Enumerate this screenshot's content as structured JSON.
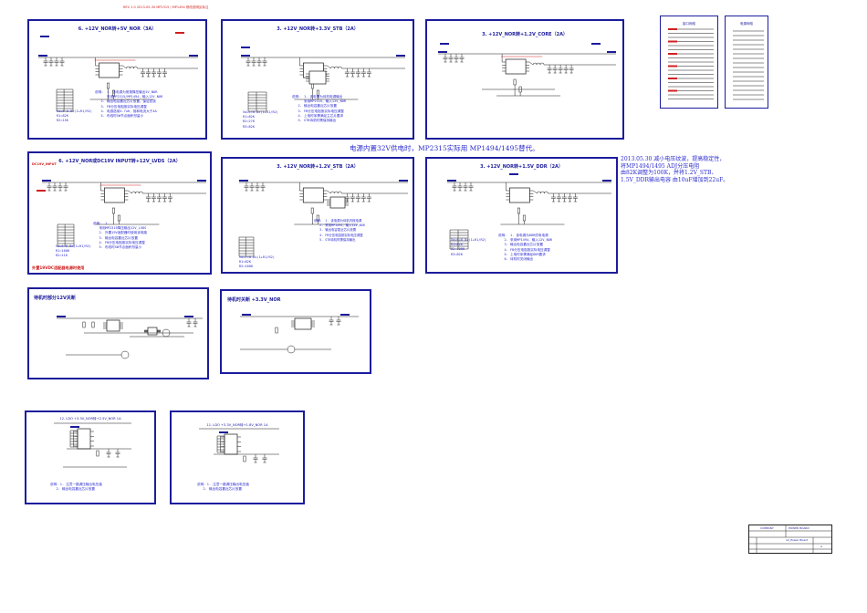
{
  "top_note": "REV 1.0  2013-05-30  MP2315 / MP1494  修改说明见标注",
  "center_note": "电源内置32V供电时，MP2315实际用 MP1494/1495替代。",
  "right_note": "2013.05.30 减小电压纹波，提高稳定性，\n将MP1494/1495 ADJ分压电阻\n由82K调整为100K，并将1.2V_STB、\n1.5V_DDR输出电容 由10uF增加到22uF。",
  "red_warning": "外置19VDC适配器电源时使用",
  "red_label_dc": "DC19V_INPUT",
  "blocks": {
    "b1": {
      "title": "6. +12V_NOR转+5V_NOR（3A）",
      "notes": "说明： 1. 该电源为常规降压输出5V_NOR\n      采用MP2315/MP1494，输入12V_NOR\n   2. 输出电容靠近芯片放置，保证纹波\n   3. FB分压电阻按实际电压调整\n   4. 电感选用4.7uH，饱和电流大于4A\n   5. 布线时SW节点面积尽量小",
      "volt": "Vout=0.8x(1+R1/R2)\nR1=82K\nR2=15K"
    },
    "b2": {
      "title": "3. +12V_NOR转+3.3V_STB（2A）",
      "notes": "说明： 1. 该电源为待机电源输出\n      采用MP2315，输入12V_NOR\n   2. 输出电容靠近芯片放置\n   3. FB分压电阻按实际电压调整\n   4. 上电时序需满足主芯片要求\n   5. STB待机时需保持输出",
      "volt": "Vout=0.8x(1+R1/R2)\nR1=82K\nR2=27K\nR3=82K"
    },
    "b3": {
      "title": "3. +12V_NOR转+1.2V_CORE（2A）"
    },
    "b4": {
      "title": "6. +12V_NOR或DC19V INPUT转+12V_LVDS（2A）",
      "notes": "说明： 1.\n   采用MP2315降压输出12V_LVDS\n   2. 外置19V适配器时使用该电路\n   3. 输出电容靠近芯片放置\n   4. FB分压电阻按实际电压调整\n   5. 布线时SW节点面积尽量小",
      "volt": "Vout=0.8x(1+R1/R2)\nR1=160K\nR2=11K"
    },
    "b5": {
      "title": "3. +12V_NOR转+1.2V_STB（2A）",
      "notes": "说明： 1. 该电源为待机内核电源\n   2. 采用MP1494，输入12V_NOR\n   3. 输出电容靠近芯片放置\n   4. FB分压电阻按实际电压调整\n   5. STB待机时需保持输出",
      "volt": "Vout=0.8x(1+R1/R2)\nR1=82K\nR2=160K"
    },
    "b6": {
      "title": "3. +12V_NOR转+1.5V_DDR（2A）",
      "notes": "说明： 1. 该电源为DDR供电电源\n   2. 采用MP1494，输入12V_NOR\n   3. 输出电容靠近芯片放置\n   4. FB分压电阻按实际电压调整\n   5. 上电时序需满足DDR要求\n   6. 待机时关闭输出",
      "volt": "Vout=0.8x(1+R1/R2)\nR1=82K\nR2=100K\nR3=82K"
    },
    "b7": {
      "title": "待机时部分12V关断"
    },
    "b8": {
      "title": "待机时关断 +3.3V_NOR"
    },
    "b9": {
      "title": "12. LDO +3.3V_NOR转+2.5V_NOR 1A",
      "notes": "说明：1. 注意一路调压输出电压值\n   2. 输出电容靠近芯片放置"
    },
    "b10": {
      "title": "11. LDO +3.3V_NOR转+1.8V_NOR 1A",
      "notes": "说明：1. 注意一路调压输出电压值\n   2. 输出电容靠近芯片放置"
    },
    "b11": {
      "title": "接口网络"
    },
    "b12": {
      "title": "电源网络"
    }
  },
  "title_block": {
    "company": "COMPANY",
    "drawing": "POWER BOARD",
    "sheet": "12_Power Board",
    "rev": "A"
  },
  "colors": {
    "frame": "#1c1c9c",
    "note": "#2b2bd0",
    "wire": "#1a1a1a",
    "red": "#d02020"
  }
}
